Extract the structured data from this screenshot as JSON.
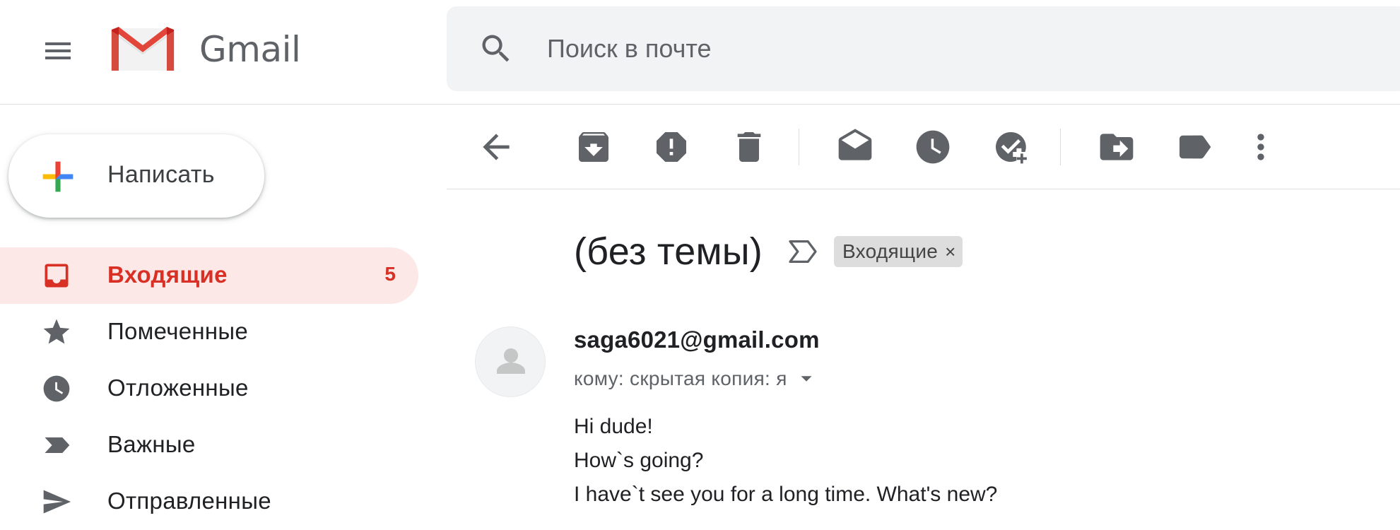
{
  "header": {
    "menu_icon": "hamburger-menu-icon",
    "logo_icon": "gmail-logo-icon",
    "logo_text": "Gmail",
    "search": {
      "icon": "search-icon",
      "placeholder": "Поиск в почте",
      "value": ""
    }
  },
  "sidebar": {
    "compose_label": "Написать",
    "compose_icon": "plus-icon",
    "items": [
      {
        "label": "Входящие",
        "icon": "inbox-icon",
        "count": "5",
        "active": true
      },
      {
        "label": "Помеченные",
        "icon": "star-icon",
        "count": "",
        "active": false
      },
      {
        "label": "Отложенные",
        "icon": "clock-icon",
        "count": "",
        "active": false
      },
      {
        "label": "Важные",
        "icon": "important-icon",
        "count": "",
        "active": false
      },
      {
        "label": "Отправленные",
        "icon": "send-icon",
        "count": "",
        "active": false
      }
    ]
  },
  "toolbar": {
    "buttons": [
      {
        "icon": "back-arrow-icon"
      },
      {
        "icon": "archive-icon"
      },
      {
        "icon": "report-spam-icon"
      },
      {
        "icon": "delete-icon"
      },
      {
        "icon": "mark-unread-icon"
      },
      {
        "icon": "snooze-icon"
      },
      {
        "icon": "add-to-tasks-icon"
      },
      {
        "icon": "move-to-icon"
      },
      {
        "icon": "label-icon"
      },
      {
        "icon": "more-vert-icon"
      }
    ]
  },
  "message": {
    "subject": "(без темы)",
    "importance_icon": "importance-marker-icon",
    "label_chip": "Входящие",
    "label_chip_close": "×",
    "avatar_icon": "default-avatar-icon",
    "sender": "saga6021@gmail.com",
    "recipients": "кому: скрытая копия: я",
    "recipients_toggle_icon": "dropdown-arrow-icon",
    "body_lines": [
      "Hi dude!",
      "How`s going?",
      "I have`t see you for a long time. What's new?"
    ]
  },
  "colors": {
    "accent_red": "#d93025",
    "active_bg": "#fce8e6",
    "icon_gray": "#5f6368",
    "search_bg": "#f1f3f4",
    "chip_bg": "#dddddd"
  }
}
